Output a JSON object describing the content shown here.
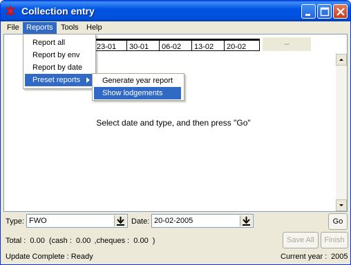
{
  "window": {
    "title": "Collection entry"
  },
  "menubar": {
    "file": "File",
    "reports": "Reports",
    "tools": "Tools",
    "help": "Help"
  },
  "reports_menu": {
    "items": [
      "Report all",
      "Report by env",
      "Report by date",
      "Preset reports"
    ]
  },
  "preset_submenu": {
    "items": [
      "Generate year report",
      "Show lodgements"
    ]
  },
  "grid": {
    "header_dates": [
      "23-01",
      "30-01",
      "06-02",
      "13-02",
      "20-02"
    ],
    "header_more": "--",
    "instruction": "Select date and type, and then press \"Go\""
  },
  "controls": {
    "type_label": "Type:",
    "type_value": "FWO",
    "date_label": "Date:",
    "date_value": "20-02-2005",
    "go_label": "Go"
  },
  "totals": {
    "total_label": "Total :",
    "total_value": "0.00",
    "cash_label": "(cash :",
    "cash_value": "0.00",
    "cheques_label": ",cheques :",
    "cheques_value": "0.00",
    "close_paren": ")"
  },
  "actions": {
    "save_all": "Save All",
    "finish": "Finish"
  },
  "status": {
    "message": "Update Complete : Ready",
    "year_label": "Current year :",
    "year_value": "2005"
  }
}
